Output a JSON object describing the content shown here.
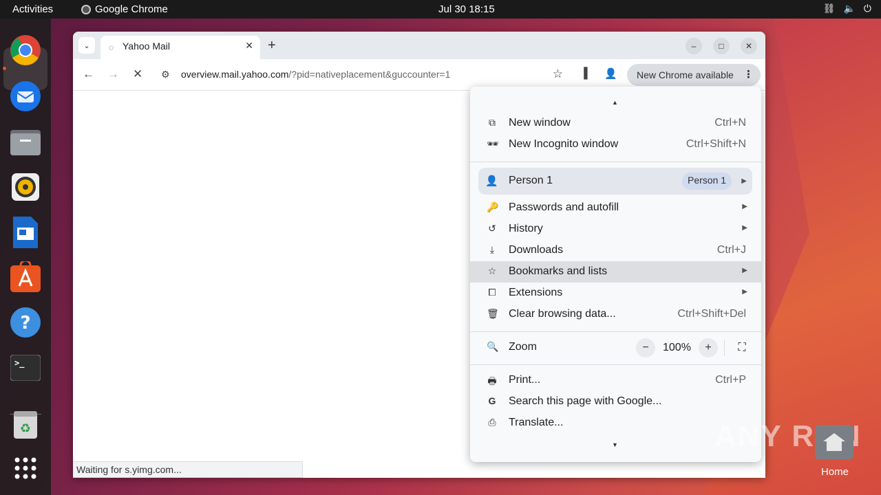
{
  "topbar": {
    "activities": "Activities",
    "app_name": "Google Chrome",
    "clock": "Jul 30  18:15",
    "tray_icons": [
      "network-icon",
      "volume-icon",
      "power-icon"
    ]
  },
  "dock": {
    "items": [
      "chrome-icon",
      "thunderbird-icon",
      "files-icon",
      "rhythmbox-icon",
      "writer-icon",
      "app-center-icon",
      "help-icon",
      "terminal-icon",
      "trash-icon",
      "app-grid-icon"
    ]
  },
  "browser": {
    "tab": {
      "title": "Yahoo Mail",
      "close": "✕"
    },
    "new_tab": "+",
    "window_buttons": {
      "minimize": "–",
      "maximize": "□",
      "close": "✕"
    },
    "url_host": "overview.mail.yahoo.com",
    "url_rest": "/?pid=nativeplacement&guccounter=1",
    "update_chip": "New Chrome available",
    "status": "Waiting for s.yimg.com..."
  },
  "menu": {
    "new_window": {
      "label": "New window",
      "shortcut": "Ctrl+N"
    },
    "incognito": {
      "label": "New Incognito window",
      "shortcut": "Ctrl+Shift+N"
    },
    "person": {
      "label": "Person 1",
      "chip": "Person 1"
    },
    "passwords": {
      "label": "Passwords and autofill"
    },
    "history": {
      "label": "History"
    },
    "downloads": {
      "label": "Downloads",
      "shortcut": "Ctrl+J"
    },
    "bookmarks": {
      "label": "Bookmarks and lists"
    },
    "extensions": {
      "label": "Extensions"
    },
    "clear": {
      "label": "Clear browsing data...",
      "shortcut": "Ctrl+Shift+Del"
    },
    "zoom": {
      "label": "Zoom",
      "value": "100%",
      "minus": "−",
      "plus": "+"
    },
    "print": {
      "label": "Print...",
      "shortcut": "Ctrl+P"
    },
    "search_page": {
      "label": "Search this page with Google..."
    },
    "translate": {
      "label": "Translate..."
    }
  },
  "desktop": {
    "home_label": "Home",
    "watermark": "ANY RUN"
  },
  "colors": {
    "accent": "#e95420",
    "menu_highlight": "#dcdee1"
  }
}
